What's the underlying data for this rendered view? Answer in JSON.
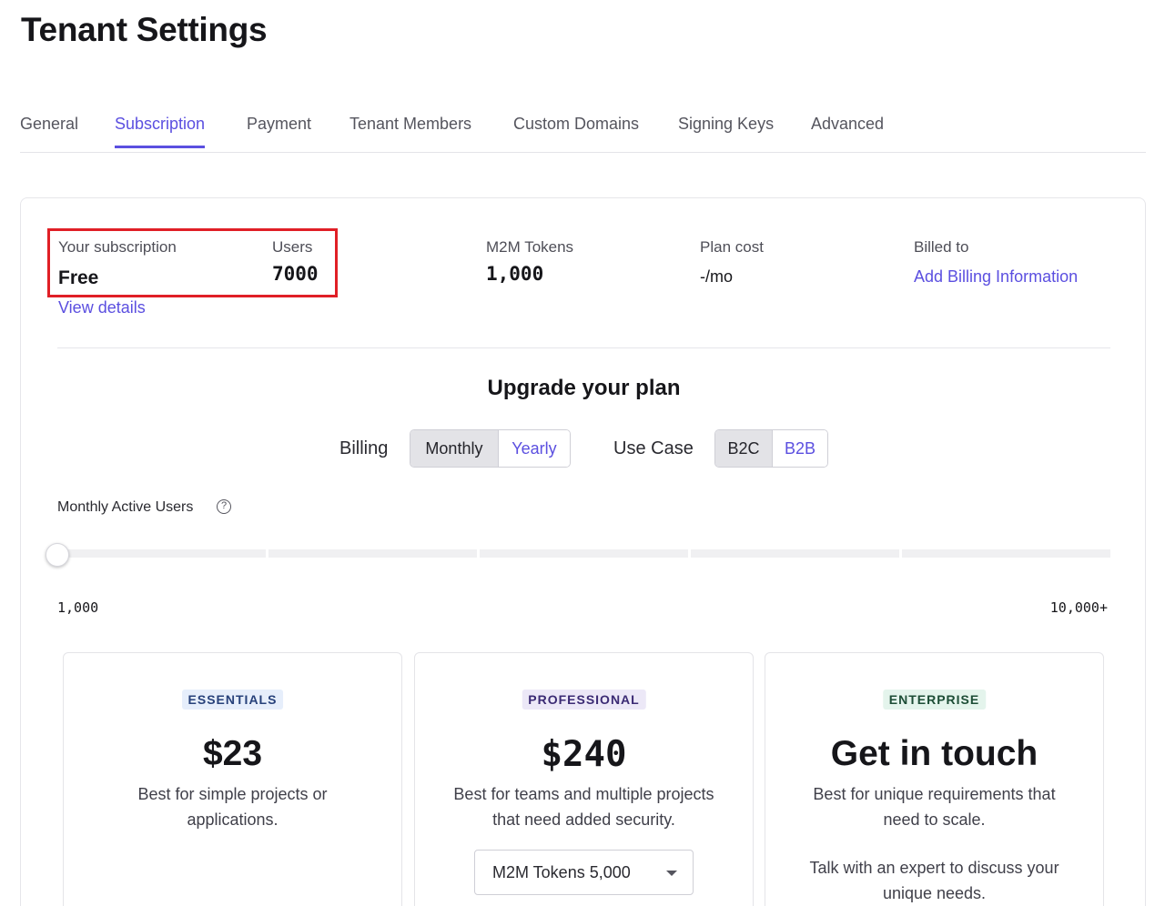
{
  "page": {
    "title": "Tenant Settings"
  },
  "tabs": [
    {
      "label": "General",
      "active": false
    },
    {
      "label": "Subscription",
      "active": true
    },
    {
      "label": "Payment",
      "active": false
    },
    {
      "label": "Tenant Members",
      "active": false
    },
    {
      "label": "Custom Domains",
      "active": false
    },
    {
      "label": "Signing Keys",
      "active": false
    },
    {
      "label": "Advanced",
      "active": false
    }
  ],
  "summary": {
    "subscription_label": "Your subscription",
    "subscription_value": "Free",
    "view_details": "View details",
    "users_label": "Users",
    "users_value": "7000",
    "m2m_label": "M2M Tokens",
    "m2m_value": "1,000",
    "plan_cost_label": "Plan cost",
    "plan_cost_value": "-/mo",
    "billed_label": "Billed to",
    "billed_link": "Add Billing Information"
  },
  "upgrade": {
    "title": "Upgrade your plan",
    "billing_label": "Billing",
    "billing_options": [
      "Monthly",
      "Yearly"
    ],
    "billing_selected": "Monthly",
    "usecase_label": "Use Case",
    "usecase_options": [
      "B2C",
      "B2B"
    ],
    "usecase_selected": "B2C",
    "mau_label": "Monthly Active Users",
    "help_icon": "?",
    "slider_min": "1,000",
    "slider_max": "10,000+",
    "slider_fraction": 0
  },
  "plans": [
    {
      "badge": "ESSENTIALS",
      "price": "$23",
      "description": "Best for simple projects or applications."
    },
    {
      "badge": "PROFESSIONAL",
      "price": "$240",
      "description": "Best for teams and multiple projects that need added security.",
      "select_value": "M2M Tokens 5,000"
    },
    {
      "badge": "ENTERPRISE",
      "price": "Get in touch",
      "description": "Best for unique requirements that need to scale.",
      "description2": "Talk with an expert to discuss your unique needs."
    }
  ],
  "colors": {
    "accent": "#5b4fe0",
    "highlight": "#e01f26"
  }
}
